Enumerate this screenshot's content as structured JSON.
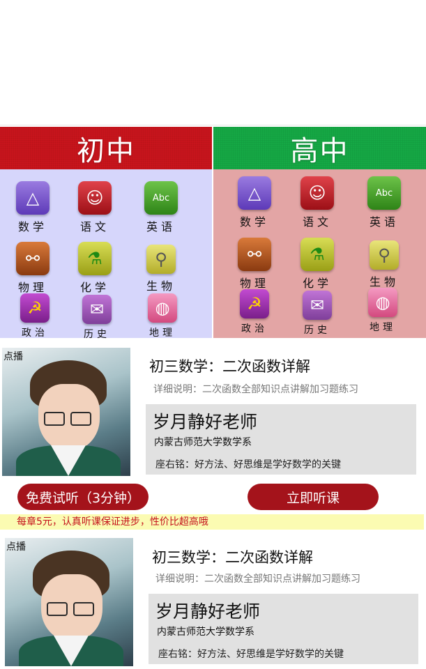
{
  "levels": {
    "junior": "初中",
    "senior": "高中"
  },
  "subjects_junior": [
    {
      "label": "数学",
      "icon": "geometry-ruler-icon"
    },
    {
      "label": "语文",
      "icon": "luxun-portrait-icon"
    },
    {
      "label": "英语",
      "icon": "abc-book-icon"
    },
    {
      "label": "物理",
      "icon": "newtons-cradle-icon"
    },
    {
      "label": "化学",
      "icon": "test-tube-icon"
    },
    {
      "label": "生物",
      "icon": "microscope-icon"
    },
    {
      "label": "政治",
      "icon": "hammer-sickle-icon"
    },
    {
      "label": "历史",
      "icon": "scroll-icon"
    },
    {
      "label": "地理",
      "icon": "globe-icon"
    }
  ],
  "subjects_senior": [
    {
      "label": "数学",
      "icon": "geometry-ruler-icon"
    },
    {
      "label": "语文",
      "icon": "luxun-portrait-icon"
    },
    {
      "label": "英语",
      "icon": "abc-book-icon"
    },
    {
      "label": "物理",
      "icon": "newtons-cradle-icon"
    },
    {
      "label": "化学",
      "icon": "test-tube-icon"
    },
    {
      "label": "生物",
      "icon": "microscope-icon"
    },
    {
      "label": "政治",
      "icon": "hammer-sickle-icon"
    },
    {
      "label": "历史",
      "icon": "scroll-icon"
    },
    {
      "label": "地理",
      "icon": "globe-icon"
    }
  ],
  "courses": [
    {
      "tag": "点播",
      "title": "初三数学：二次函数详解",
      "description": "详细说明：二次函数全部知识点讲解加习题练习",
      "teacher": "岁月静好老师",
      "school": "内蒙古师范大学数学系",
      "motto": "座右铭：好方法、好思维是学好数学的关键",
      "trial_button": "免费试听（3分钟）",
      "listen_button": "立即听课",
      "note": "每章5元，认真听课保证进步，性价比超高哦"
    },
    {
      "tag": "点播",
      "title": "初三数学：二次函数详解",
      "description": "详细说明：二次函数全部知识点讲解加习题练习",
      "teacher": "岁月静好老师",
      "school": "内蒙古师范大学数学系",
      "motto": "座右铭：好方法、好思维是学好数学的关键"
    }
  ],
  "colors": {
    "junior_header": "#c8141c",
    "senior_header": "#15a845",
    "junior_panel": "#d6d6fb",
    "senior_panel": "#e3a5a5",
    "button": "#a4131b",
    "note_bg": "#fbfbb2",
    "note_text": "#c4121b"
  }
}
